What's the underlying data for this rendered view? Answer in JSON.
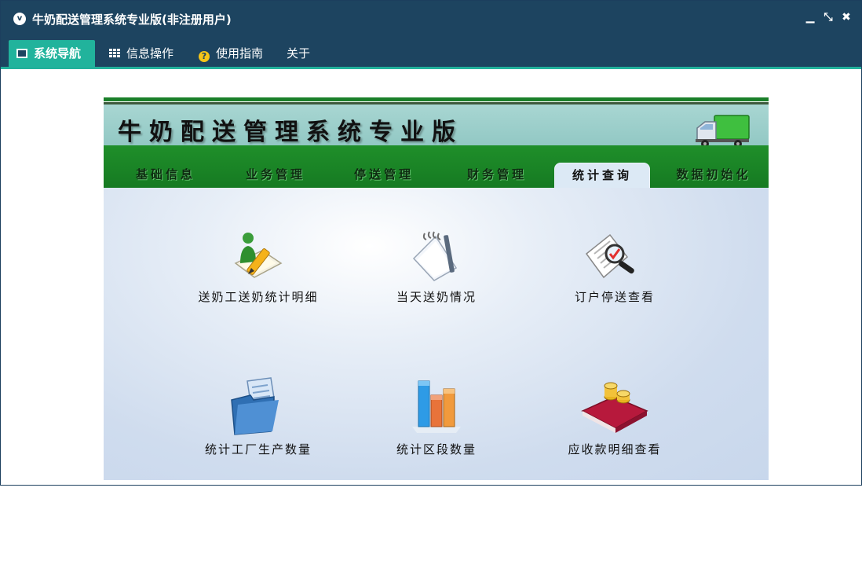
{
  "window": {
    "title": "牛奶配送管理系统专业版(非注册用户)",
    "logo": "v",
    "controls": {
      "minimize": "▁",
      "restore": "⤡",
      "close": "✖"
    }
  },
  "menubar": {
    "items": [
      {
        "label": "系统导航",
        "icon": "monitor-icon",
        "active": true
      },
      {
        "label": "信息操作",
        "icon": "grid-icon",
        "active": false
      },
      {
        "label": "使用指南",
        "icon": "help-icon",
        "active": false
      },
      {
        "label": "关于",
        "icon": "",
        "active": false
      }
    ]
  },
  "banner": {
    "title": "牛奶配送管理系统专业版",
    "tabs": [
      {
        "label": "基础信息",
        "active": false
      },
      {
        "label": "业务管理",
        "active": false
      },
      {
        "label": "停送管理",
        "active": false
      },
      {
        "label": "财务管理",
        "active": false
      },
      {
        "label": "统计查询",
        "active": true
      },
      {
        "label": "数据初始化",
        "active": false
      }
    ]
  },
  "functions": [
    {
      "label": "送奶工送奶统计明细",
      "icon": "person-pencil-icon"
    },
    {
      "label": "当天送奶情况",
      "icon": "notepad-icon"
    },
    {
      "label": "订户停送查看",
      "icon": "document-search-icon"
    },
    {
      "label": "统计工厂生产数量",
      "icon": "folder-document-icon"
    },
    {
      "label": "统计区段数量",
      "icon": "bar-chart-icon"
    },
    {
      "label": "应收款明细查看",
      "icon": "book-coins-icon"
    }
  ],
  "colors": {
    "titlebar": "#1d4460",
    "menu_active": "#21b39c",
    "banner_green": "#1f8f2a",
    "banner_title_bg": "#a8d6d2"
  }
}
